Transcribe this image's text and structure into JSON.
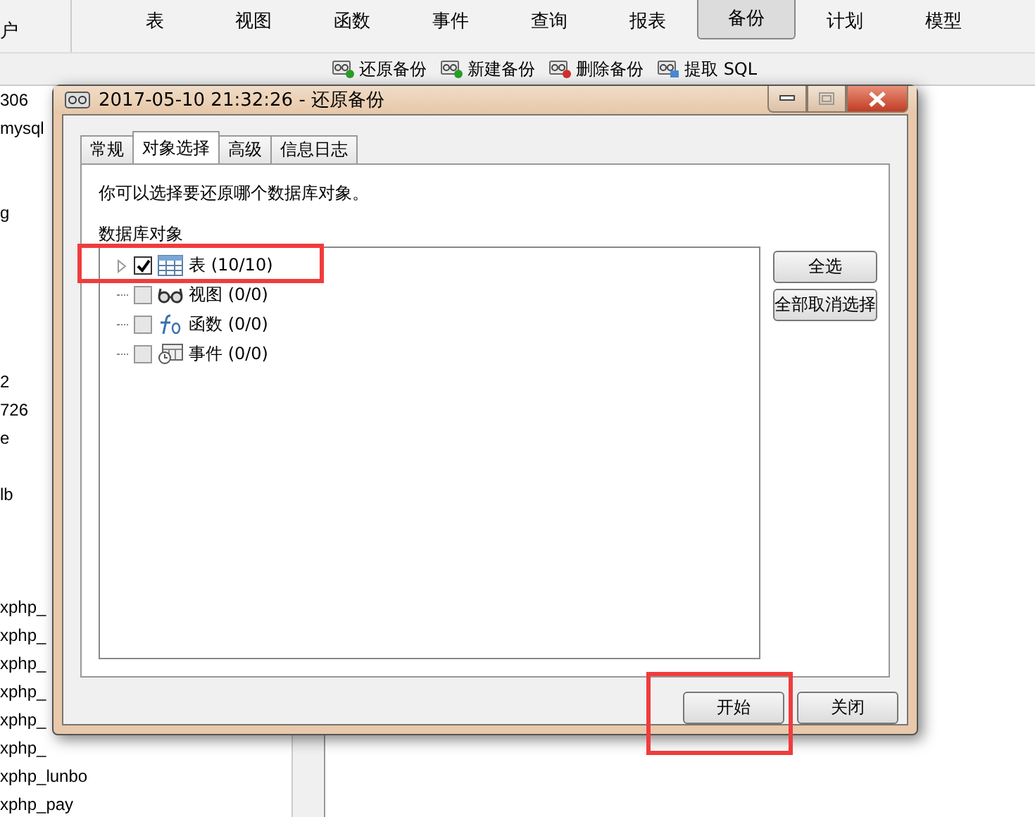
{
  "toolbar": {
    "left_text": "户",
    "buttons": [
      {
        "label": "表",
        "selected": false
      },
      {
        "label": "视图",
        "selected": false
      },
      {
        "label": "函数",
        "selected": false
      },
      {
        "label": "事件",
        "selected": false
      },
      {
        "label": "查询",
        "selected": false
      },
      {
        "label": "报表",
        "selected": false
      },
      {
        "label": "备份",
        "selected": true
      },
      {
        "label": "计划",
        "selected": false
      },
      {
        "label": "模型",
        "selected": false
      }
    ]
  },
  "actions": [
    {
      "label": "还原备份",
      "kind": "restore"
    },
    {
      "label": "新建备份",
      "kind": "new"
    },
    {
      "label": "删除备份",
      "kind": "delete"
    },
    {
      "label": "提取 SQL",
      "kind": "extract"
    }
  ],
  "sidebar": {
    "items": [
      "306",
      "mysql",
      "g",
      "2",
      "726",
      "e",
      "lb",
      "xphp_",
      "xphp_",
      "xphp_",
      "xphp_",
      "xphp_",
      "xphp_",
      "xphp_lunbo",
      "xphp_pay"
    ]
  },
  "dialog": {
    "title": "2017-05-10 21:32:26 - 还原备份",
    "tabs": [
      {
        "label": "常规",
        "selected": false
      },
      {
        "label": "对象选择",
        "selected": true
      },
      {
        "label": "高级",
        "selected": false
      },
      {
        "label": "信息日志",
        "selected": false
      }
    ],
    "description": "你可以选择要还原哪个数据库对象。",
    "tree_label": "数据库对象",
    "tree": [
      {
        "label": "表 (10/10)",
        "kind": "table",
        "checked": true,
        "expandable": true
      },
      {
        "label": "视图 (0/0)",
        "kind": "view",
        "checked": false,
        "expandable": false
      },
      {
        "label": "函数 (0/0)",
        "kind": "function",
        "checked": false,
        "expandable": false
      },
      {
        "label": "事件 (0/0)",
        "kind": "event",
        "checked": false,
        "expandable": false
      }
    ],
    "side_buttons": [
      "全选",
      "全部取消选择"
    ],
    "buttons": [
      "开始",
      "关闭"
    ]
  }
}
